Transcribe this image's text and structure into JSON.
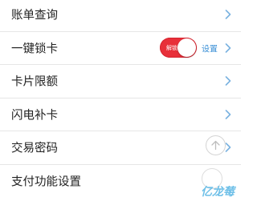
{
  "menu": {
    "items": [
      {
        "label": "账单查询"
      },
      {
        "label": "一键锁卡",
        "toggle_text": "解锁",
        "toggle_on": true,
        "settings_label": "设置"
      },
      {
        "label": "卡片限额"
      },
      {
        "label": "闪电补卡"
      },
      {
        "label": "交易密码"
      },
      {
        "label": "支付功能设置"
      }
    ]
  },
  "watermark": {
    "text": "亿龙莓"
  },
  "colors": {
    "toggle_on": "#e8303a",
    "link": "#3a8fd6",
    "chevron": "#7bb3e0",
    "divider": "#e6e6e6"
  },
  "icons": {
    "chevron": "chevron-right-icon",
    "scroll_top": "arrow-up-icon"
  }
}
